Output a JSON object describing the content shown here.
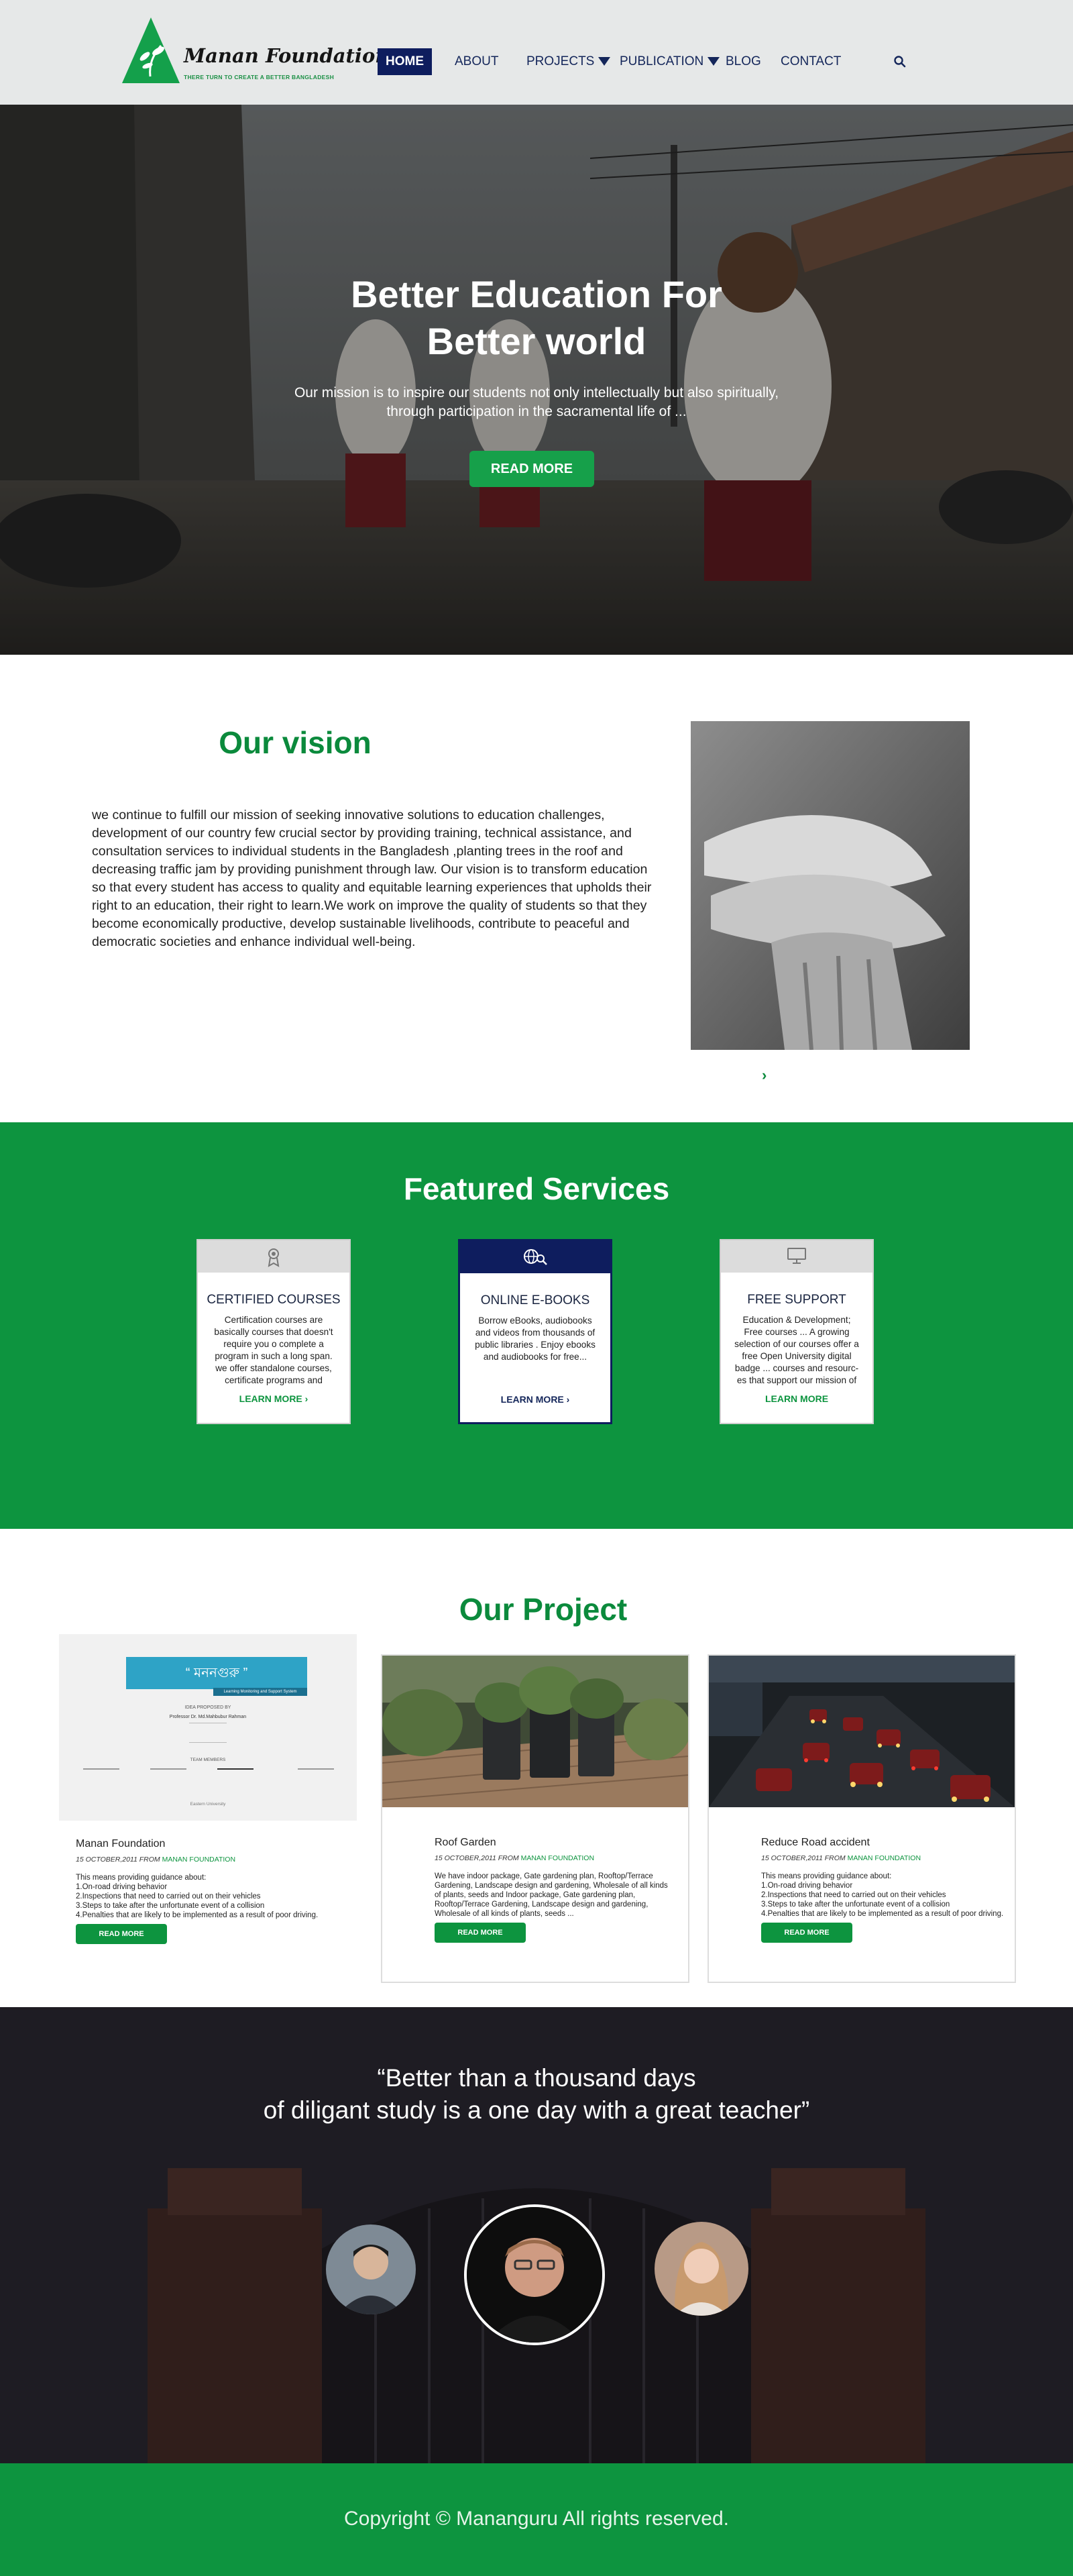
{
  "colors": {
    "brand_green": "#0d943f",
    "navy": "#0e1d5e",
    "header_bg": "#e6e8e8"
  },
  "header": {
    "logo_name": "Manan Foundation",
    "logo_tagline": "THERE TURN TO CREATE A BETTER BANGLADESH",
    "nav": {
      "home": "HOME",
      "about": "ABOUT",
      "projects": "PROJECTS",
      "publication": "PUBLICATION",
      "blog": "BLOG",
      "contact": "CONTACT"
    },
    "search_icon": "search-icon"
  },
  "hero": {
    "title_line1": "Better Education For",
    "title_line2": "Better world",
    "subtitle_line1": "Our mission is to inspire our students not only intellectually but also spiritually,",
    "subtitle_line2": "through participation in the sacramental life of ...",
    "button": "READ MORE"
  },
  "vision": {
    "title": "Our vision",
    "text": "we continue to fulfill our mission of seeking innovative solutions to education challenges, development of our country few crucial sector by providing training, technical assistance, and consultation services to individual students in the Bangladesh ,planting trees in the roof and decreasing traffic jam by providing punishment through law. Our vision is to transform education so that every student has access to quality and equitable learning experiences that upholds their right to an education, their right to learn.We work on improve the quality of  students so that they become economically productive, develop sustainable  livelihoods, contribute to peaceful and democratic societies and enhance individual well-being.",
    "arrow": "›"
  },
  "services": {
    "title": "Featured Services",
    "cards": [
      {
        "icon": "certificate-icon",
        "title": "CERTIFIED COURSES",
        "text": "Certification courses are basically courses that doesn't require you o complete a program in such a long span. we offer standalone courses, certificate programs and",
        "link": "LEARN MORE"
      },
      {
        "icon": "globe-search-icon",
        "title": "ONLINE E-BOOKS",
        "text": "Borrow eBooks, audiobooks and videos from thousands of public libraries . Enjoy ebooks and audiobooks for free...",
        "link": "LEARN MORE"
      },
      {
        "icon": "monitor-icon",
        "title": "FREE SUPPORT",
        "text": "Education & Development; Free courses ... A growing selection of our courses offer a free Open University digital badge ... courses and resourc- es that support our mission of",
        "link": "LEARN MORE"
      }
    ]
  },
  "projects": {
    "title": "Our Project",
    "doc": {
      "banner": "“ মননগুরু ”",
      "ribbon": "Learning Monitoring and Support System",
      "proposed": "IDEA PROPOSED BY",
      "professor": "Professor Dr. Md.Mahbubur Rahman",
      "members": "TEAM MEMBERS",
      "footer": "Eastern University"
    },
    "items": [
      {
        "name": "Manan Foundation",
        "date": "15 OCTOBER,2011 FROM",
        "org": "MANAN FOUNDATION",
        "desc": "This means providing guidance about:\n1.On-road driving behavior\n2.Inspections that need to carried out on their vehicles\n3.Steps to take after the unfortunate event of a collision\n4.Penalties that are likely to be implemented as a result of poor driving.",
        "button": "READ MORE"
      },
      {
        "name": "Roof Garden",
        "date": "15 OCTOBER,2011 FROM",
        "org": "MANAN FOUNDATION",
        "desc": "We have indoor package, Gate gardening plan, Rooftop/Terrace Gardening, Landscape design and gardening, Wholesale of all kinds of plants, seeds and  Indoor package, Gate gardening plan, Rooftop/Terrace Gardening, Landscape design and gardening, Wholesale of all kinds of plants, seeds ...",
        "button": "READ MORE"
      },
      {
        "name": "Reduce Road accident",
        "date": "15 OCTOBER,2011 FROM",
        "org": "MANAN FOUNDATION",
        "desc": "This means providing guidance about:\n1.On-road driving behavior\n2.Inspections that need to carried out on their vehicles\n3.Steps to take after the unfortunate event of a collision\n4.Penalties that are likely to be implemented as a result of poor driving.",
        "button": "READ MORE"
      }
    ]
  },
  "quote": {
    "line1": "“Better than a thousand days",
    "line2": "of diligant study is a one day with a great teacher”"
  },
  "footer": {
    "copyright": "Copyright © Mananguru All rights reserved."
  }
}
